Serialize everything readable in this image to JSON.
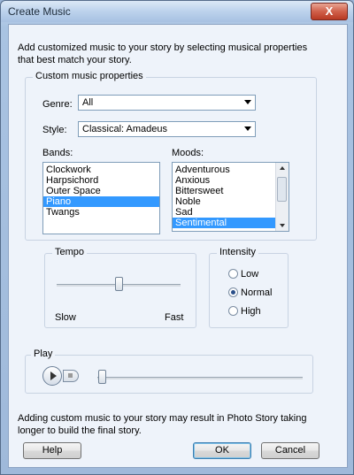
{
  "window": {
    "title": "Create Music",
    "close_glyph": "X"
  },
  "intro_text": "Add customized music to your story by selecting musical properties that best match your story.",
  "custom": {
    "group_label": "Custom music properties",
    "genre_label": "Genre:",
    "genre_value": "All",
    "style_label": "Style:",
    "style_value": "Classical: Amadeus",
    "bands_label": "Bands:",
    "bands": [
      "Clockwork",
      "Harpsichord",
      "Outer Space",
      "Piano",
      "Twangs"
    ],
    "bands_selected": "Piano",
    "moods_label": "Moods:",
    "moods": [
      "Adventurous",
      "Anxious",
      "Bittersweet",
      "Noble",
      "Sad",
      "Sentimental"
    ],
    "moods_selected": "Sentimental"
  },
  "tempo": {
    "label": "Tempo",
    "slow": "Slow",
    "fast": "Fast",
    "value_fraction": 0.5
  },
  "intensity": {
    "label": "Intensity",
    "options": [
      "Low",
      "Normal",
      "High"
    ],
    "selected": "Normal"
  },
  "play": {
    "label": "Play",
    "position_fraction": 0.0
  },
  "footer_note": "Adding custom music to your story may result in Photo Story taking longer to build the final story.",
  "buttons": {
    "help": "Help",
    "ok": "OK",
    "cancel": "Cancel"
  },
  "icons": {
    "play": "play-icon",
    "stop": "stop-icon",
    "close": "close-icon",
    "dropdown": "chevron-down-icon"
  }
}
